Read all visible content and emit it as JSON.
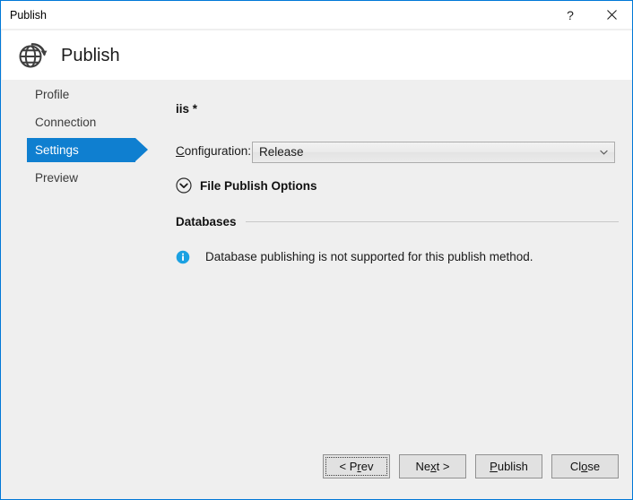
{
  "window": {
    "title": "Publish",
    "help_icon": "question-mark-icon",
    "close_icon": "close-icon",
    "border_color": "#0078d7"
  },
  "header": {
    "icon": "globe-publish-icon",
    "title": "Publish"
  },
  "sidebar": {
    "selected_index": 2,
    "highlight_color": "#0f7fd0",
    "items": [
      {
        "label": "Profile",
        "selected": false
      },
      {
        "label": "Connection",
        "selected": false
      },
      {
        "label": "Settings",
        "selected": true
      },
      {
        "label": "Preview",
        "selected": false
      }
    ]
  },
  "main": {
    "profile_name": "iis *",
    "configuration": {
      "label_prefix": "",
      "label_accel": "C",
      "label_suffix": "onfiguration:",
      "value": "Release",
      "arrow_icon": "chevron-down-icon"
    },
    "file_publish_options": {
      "label": "File Publish Options",
      "expander_icon": "chevron-down-circle-icon",
      "expanded": false
    },
    "databases": {
      "section_title": "Databases",
      "info_icon": "info-icon",
      "info_color": "#1ba1e2",
      "message": "Database publishing is not supported for this publish method."
    }
  },
  "footer": {
    "buttons": [
      {
        "prefix": "< P",
        "accel": "r",
        "suffix": "ev",
        "focused": true
      },
      {
        "prefix": "Ne",
        "accel": "x",
        "suffix": "t >",
        "focused": false
      },
      {
        "prefix": "",
        "accel": "P",
        "suffix": "ublish",
        "focused": false
      },
      {
        "prefix": "Cl",
        "accel": "o",
        "suffix": "se",
        "focused": false
      }
    ]
  }
}
